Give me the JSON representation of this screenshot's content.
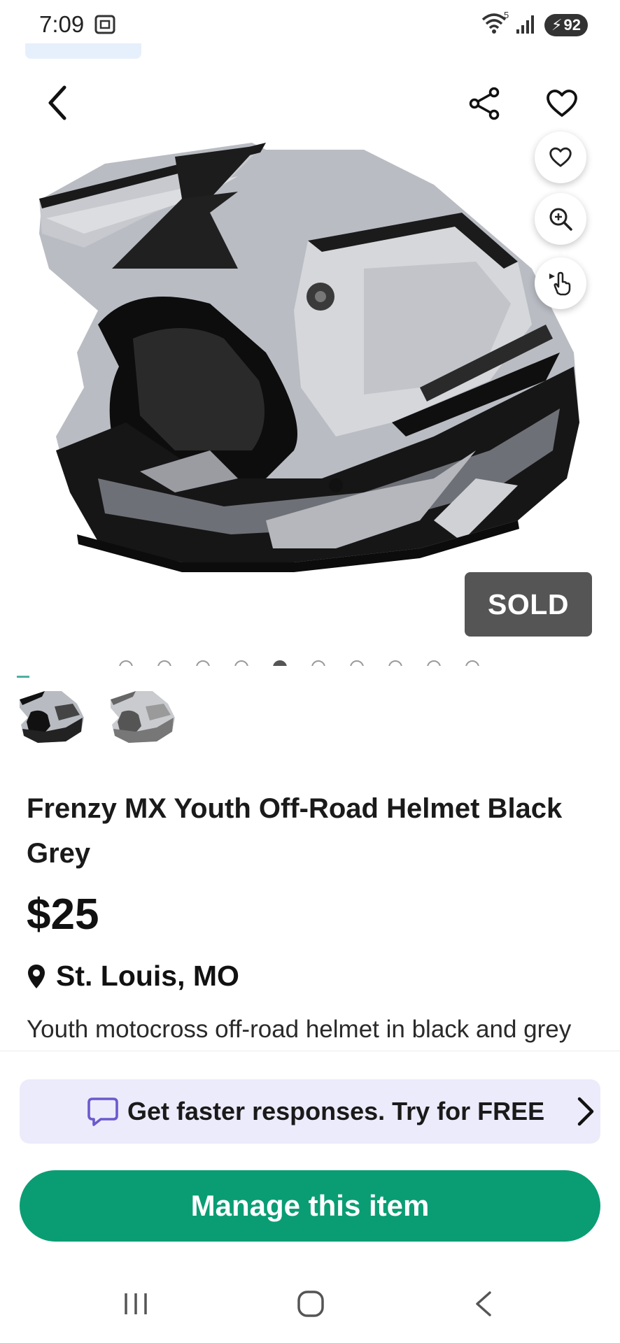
{
  "status_bar": {
    "time": "7:09",
    "wifi_superscript": "5",
    "battery_level": "92"
  },
  "product": {
    "title": "Frenzy MX Youth Off-Road Helmet Black Grey",
    "price": "$25",
    "location": "St. Louis, MO",
    "description": "Youth motocross off-road helmet in black and grey",
    "sold_badge": "SOLD",
    "image_count": 10,
    "active_image_index": 4
  },
  "promo": {
    "text": "Get faster responses. Try for FREE"
  },
  "actions": {
    "manage_label": "Manage this item"
  },
  "icons": {
    "back": "chevron-left-icon",
    "share": "share-icon",
    "favorite": "heart-icon",
    "zoom": "zoom-in-icon",
    "pointer": "hand-pointer-icon",
    "location": "map-pin-icon",
    "chat": "chat-bubble-icon"
  },
  "colors": {
    "primary_green": "#0a9d74",
    "promo_bg": "#ecebfb",
    "sold_badge_bg": "#555555",
    "chat_icon": "#6a5acd"
  }
}
